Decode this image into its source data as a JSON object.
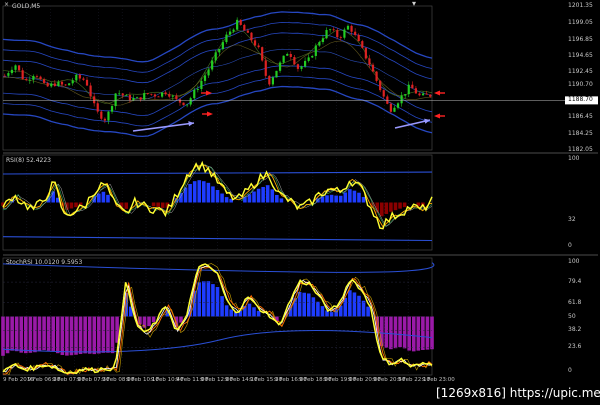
{
  "window": {
    "close_glyph": "×",
    "title": "GOLD,M5",
    "menu_glyph": "▾"
  },
  "panes": {
    "price": {
      "title": "GOLD,M5",
      "y_labels": [
        "1201.35",
        "1199.05",
        "1196.85",
        "1194.65",
        "1192.45",
        "1190.70",
        "1188.70",
        "1186.45",
        "1184.25",
        "1182.05"
      ],
      "current_price": "1188.70"
    },
    "rsi": {
      "title": "RSI(8) 52.4223",
      "y_labels": [
        "100",
        "32",
        "0"
      ]
    },
    "stoch": {
      "title": "StochRSI 10.0120 9.5953",
      "y_labels": [
        "100",
        "79.4",
        "61.8",
        "50",
        "38.2",
        "23.6",
        "0"
      ]
    }
  },
  "x_axis": {
    "labels": [
      "9 Feb 2016",
      "9 Feb 06:30",
      "9 Feb 07:00",
      "9 Feb 07:30",
      "9 Feb 08:00",
      "9 Feb 10:10",
      "9 Feb 10:40",
      "9 Feb 11:00",
      "9 Feb 12:00",
      "9 Feb 14:10",
      "9 Feb 15:30",
      "9 Feb 16:00",
      "9 Feb 18:00",
      "9 Feb 19:00",
      "9 Feb 20:00",
      "9 Feb 20:50",
      "9 Feb 22:10",
      "9 Feb 23:00"
    ]
  },
  "watermark": "[1269x816] https://upic.me/",
  "colors": {
    "background": "#000000",
    "grid": "#1c1c2c",
    "bull_candle": "#22cc22",
    "bear_candle": "#dd2222",
    "bands": "#2a4fd6",
    "rsi_main": "#ffff33",
    "rsi_signal": "#ffaa00",
    "hist_blue": "#1e3cff",
    "hist_red": "#8b0000",
    "hist_purple": "#9a1aa8",
    "arrow_red": "#ff2222",
    "arrow_blue": "#9a9aff"
  },
  "chart_data": {
    "type": "candlestick",
    "symbol": "GOLD",
    "timeframe": "M5",
    "price_range": [
      1182.05,
      1201.35
    ],
    "close_path": [
      1192.0,
      1193.6,
      1191.2,
      1192.5,
      1190.4,
      1191.0,
      1190.6,
      1191.8,
      1191.4,
      1187.2,
      1186.1,
      1189.9,
      1189.1,
      1188.8,
      1189.6,
      1189.4,
      1189.9,
      1188.6,
      1188.3,
      1190.4,
      1192.6,
      1195.2,
      1197.6,
      1199.2,
      1197.4,
      1195.8,
      1190.9,
      1193.2,
      1195.4,
      1192.9,
      1194.1,
      1196.6,
      1198.3,
      1197.1,
      1198.8,
      1196.2,
      1193.6,
      1190.4,
      1187.4,
      1188.9,
      1190.6,
      1189.2,
      1189.4
    ],
    "rsi_path": [
      44,
      58,
      49,
      43,
      53,
      71,
      36,
      41,
      46,
      63,
      70,
      46,
      38,
      51,
      45,
      43,
      39,
      58,
      79,
      90,
      86,
      72,
      58,
      53,
      63,
      74,
      81,
      59,
      52,
      44,
      49,
      59,
      64,
      61,
      74,
      66,
      45,
      25,
      34,
      40,
      46,
      42,
      52
    ],
    "stoch_path": [
      2,
      9,
      5,
      6,
      9,
      7,
      2,
      3,
      5,
      4,
      6,
      5,
      81,
      44,
      35,
      46,
      60,
      37,
      50,
      91,
      94,
      86,
      61,
      54,
      67,
      57,
      52,
      42,
      61,
      80,
      78,
      66,
      54,
      62,
      83,
      74,
      58,
      14,
      10,
      13,
      7,
      9,
      10
    ]
  }
}
